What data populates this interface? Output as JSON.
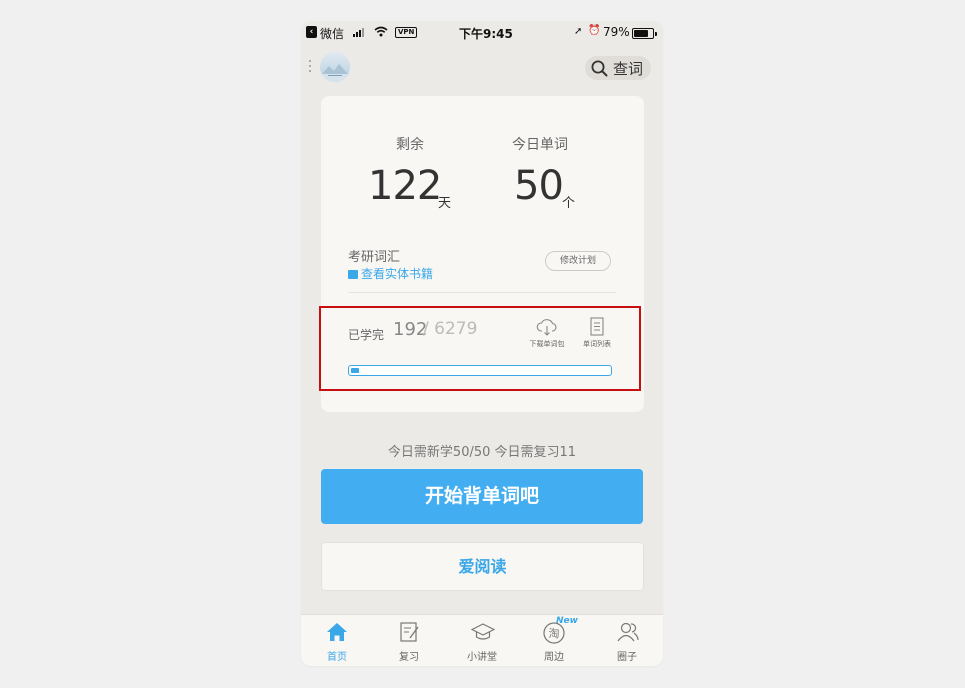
{
  "status_bar": {
    "back_app": "微信",
    "vpn": "VPN",
    "time": "下午9:45",
    "battery_percent": "79%",
    "battery_level": 0.79
  },
  "header": {
    "search_label": "查词"
  },
  "stats": {
    "remaining_label": "剩余",
    "remaining_value": "122",
    "remaining_unit": "天",
    "today_words_label": "今日单词",
    "today_words_value": "50",
    "today_words_unit": "个"
  },
  "book": {
    "title": "考研词汇",
    "link_label": "查看实体书籍",
    "edit_plan_label": "修改计划"
  },
  "progress": {
    "learned_label": "已学完",
    "learned_count": "192",
    "total_count": "/ 6279",
    "fraction": 0.0306,
    "download_label": "下载单词包",
    "word_list_label": "单词列表"
  },
  "today_summary": "今日需新学50/50  今日需复习11",
  "buttons": {
    "start": "开始背单词吧",
    "read": "爱阅读"
  },
  "tabs": [
    {
      "label": "首页",
      "icon": "home-icon",
      "active": true
    },
    {
      "label": "复习",
      "icon": "review-icon",
      "active": false
    },
    {
      "label": "小讲堂",
      "icon": "graduation-cap-icon",
      "active": false
    },
    {
      "label": "周边",
      "icon": "taobao-icon",
      "active": false,
      "badge": "New"
    },
    {
      "label": "圈子",
      "icon": "people-icon",
      "active": false
    }
  ],
  "colors": {
    "accent": "#42adf0",
    "highlight_border": "#c80f0f"
  }
}
